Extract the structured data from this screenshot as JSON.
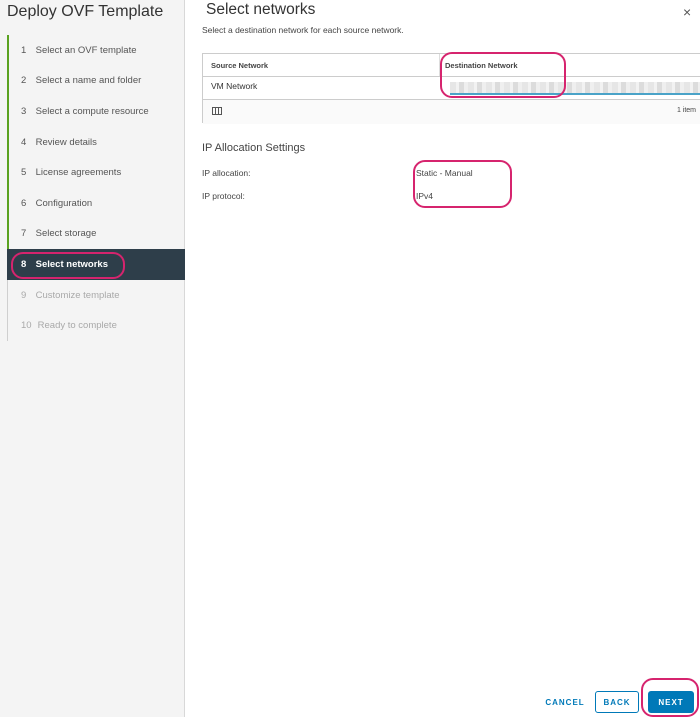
{
  "wizard": {
    "title": "Deploy OVF Template",
    "steps": [
      {
        "num": "1",
        "label": "Select an OVF template"
      },
      {
        "num": "2",
        "label": "Select a name and folder"
      },
      {
        "num": "3",
        "label": "Select a compute resource"
      },
      {
        "num": "4",
        "label": "Review details"
      },
      {
        "num": "5",
        "label": "License agreements"
      },
      {
        "num": "6",
        "label": "Configuration"
      },
      {
        "num": "7",
        "label": "Select storage"
      },
      {
        "num": "8",
        "label": "Select networks"
      },
      {
        "num": "9",
        "label": "Customize template"
      },
      {
        "num": "10",
        "label": "Ready to complete"
      }
    ]
  },
  "page": {
    "title": "Select networks",
    "subtitle": "Select a destination network for each source network.",
    "close_symbol": "×"
  },
  "network_grid": {
    "columns": [
      "Source Network",
      "Destination Network"
    ],
    "rows": [
      {
        "source": "VM Network"
      }
    ],
    "footer_count": "1 item"
  },
  "ip_settings": {
    "title": "IP Allocation Settings",
    "allocation_label": "IP allocation:",
    "allocation_value": "Static - Manual",
    "protocol_label": "IP protocol:",
    "protocol_value": "IPv4"
  },
  "footer": {
    "cancel_label": "CANCEL",
    "back_label": "BACK",
    "next_label": "NEXT"
  },
  "colors": {
    "accent": "#0079b8",
    "active_step_bg": "#2e3e4a",
    "done_step_bar": "#5aa220",
    "annotation": "#d6246e"
  }
}
